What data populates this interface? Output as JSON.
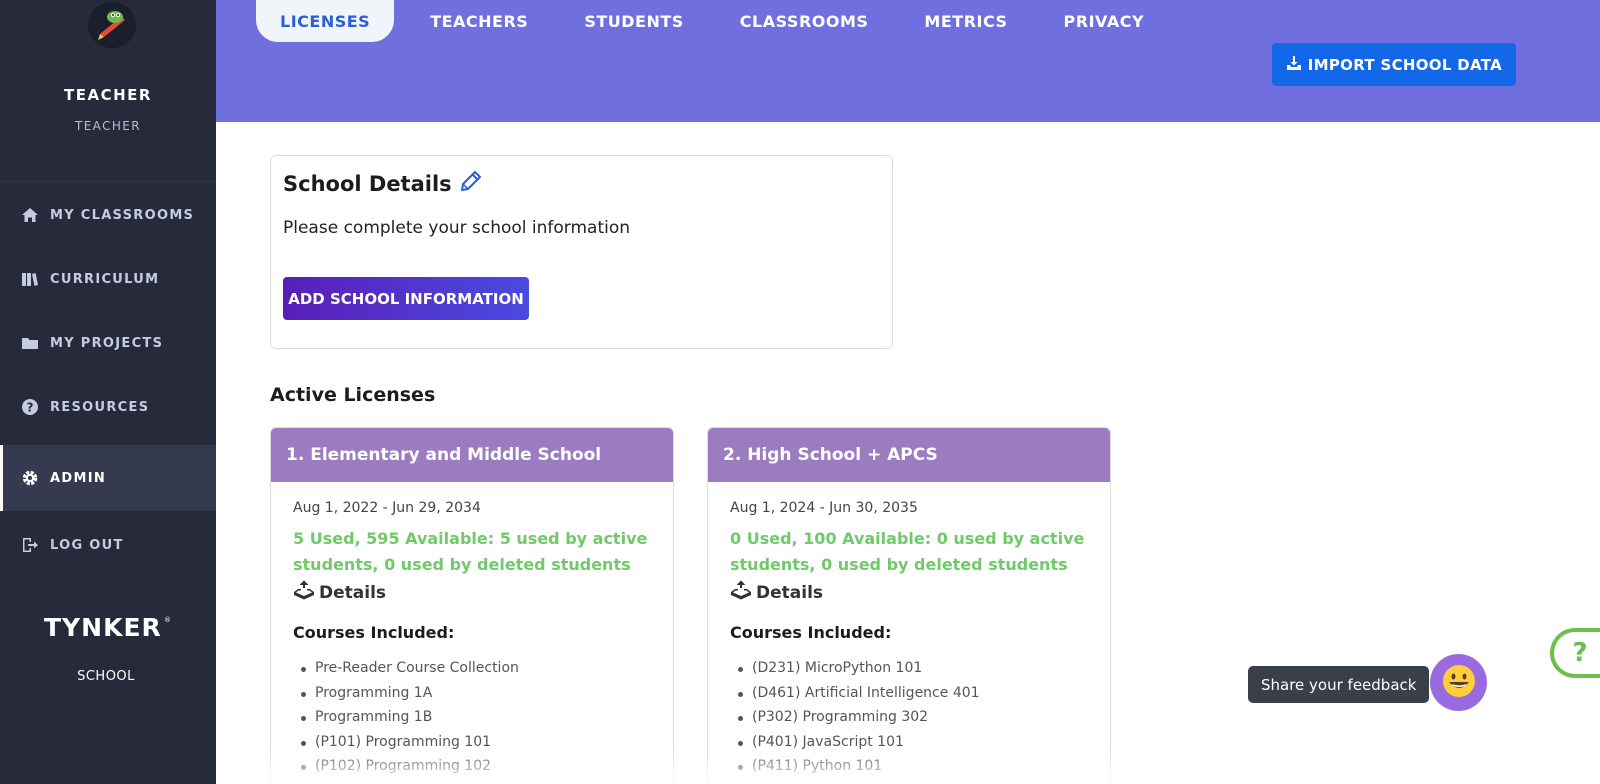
{
  "sidebar": {
    "user_name": "TEACHER",
    "user_role": "TEACHER",
    "items": [
      {
        "label": "MY CLASSROOMS",
        "icon": "home-icon"
      },
      {
        "label": "CURRICULUM",
        "icon": "books-icon"
      },
      {
        "label": "MY PROJECTS",
        "icon": "folder-icon"
      },
      {
        "label": "RESOURCES",
        "icon": "question-circle-icon"
      },
      {
        "label": "ADMIN",
        "icon": "gear-icon",
        "active": true
      },
      {
        "label": "LOG OUT",
        "icon": "logout-icon"
      }
    ],
    "brand_subtitle": "SCHOOL"
  },
  "header": {
    "tabs": [
      "LICENSES",
      "TEACHERS",
      "STUDENTS",
      "CLASSROOMS",
      "METRICS",
      "PRIVACY"
    ],
    "active_tab": "LICENSES",
    "import_label": "IMPORT SCHOOL DATA"
  },
  "school_details": {
    "title": "School Details",
    "description": "Please complete your school information",
    "button_label": "ADD SCHOOL INFORMATION"
  },
  "active_licenses": {
    "title": "Active Licenses",
    "cards": [
      {
        "title": "1. Elementary and Middle School",
        "dates": "Aug 1, 2022 - Jun 29, 2034",
        "usage": "5 Used, 595 Available: 5 used by active students, 0 used by deleted students",
        "details_label": "Details",
        "courses_label": "Courses Included:",
        "courses": [
          "Pre-Reader Course Collection",
          "Programming 1A",
          "Programming 1B",
          "(P101) Programming 101",
          "(P102) Programming 102"
        ]
      },
      {
        "title": "2. High School + APCS",
        "dates": "Aug 1, 2024 - Jun 30, 2035",
        "usage": "0 Used, 100 Available: 0 used by active students, 0 used by deleted students",
        "details_label": "Details",
        "courses_label": "Courses Included:",
        "courses": [
          "(D231) MicroPython 101",
          "(D461) Artificial Intelligence 401",
          "(P302) Programming 302",
          "(P401) JavaScript 101",
          "(P411) Python 101"
        ]
      }
    ]
  },
  "feedback": {
    "label": "Share your feedback"
  },
  "help": {
    "symbol": "?"
  },
  "colors": {
    "sidebar_bg": "#262a3b",
    "header_bg": "#6f6fe0",
    "primary_blue": "#1268e8",
    "license_header": "#9b7cc0",
    "usage_green": "#71c96a"
  }
}
